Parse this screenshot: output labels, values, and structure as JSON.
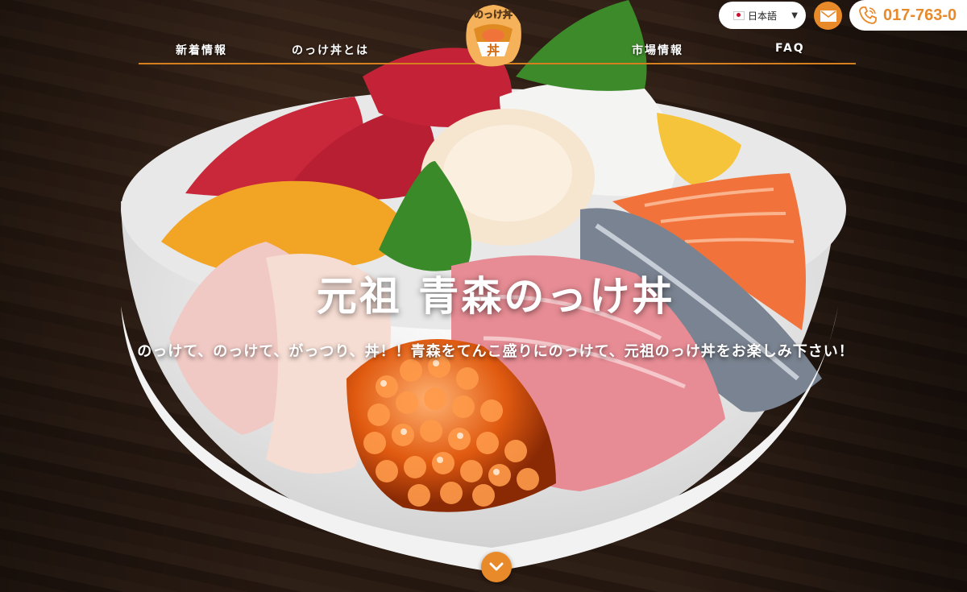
{
  "header": {
    "logo_text": "のっけ丼",
    "language_selected": "日本語",
    "phone": "017-763-0",
    "nav": [
      {
        "label": "新着情報"
      },
      {
        "label": "のっけ丼とは"
      },
      {
        "label": "市場情報"
      },
      {
        "label": "FAQ"
      }
    ]
  },
  "hero": {
    "title": "元祖 青森のっけ丼",
    "subtitle": "のっけて、のっけて、がっつり、丼！！青森をてんこ盛りにのっけて、元祖のっけ丼をお楽しみ下さい！"
  },
  "icons": {
    "mail": "mail-icon",
    "phone": "phone-icon",
    "scroll": "chevron-down-icon"
  },
  "colors": {
    "accent": "#e88a2a",
    "nav_line": "#d67f1f",
    "text": "#ffffff"
  }
}
